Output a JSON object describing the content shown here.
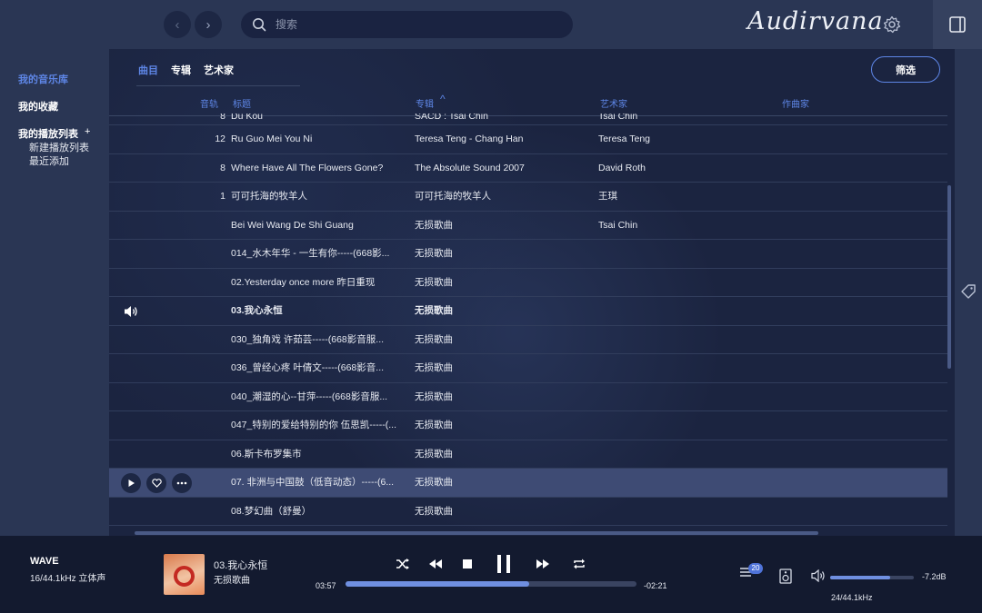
{
  "topbar": {
    "back": "‹",
    "forward": "›",
    "search_placeholder": "搜索",
    "logo": "Audirvana"
  },
  "sidebar": {
    "items": [
      {
        "label": "我的音乐库",
        "active": true
      },
      {
        "label": "我的收藏",
        "active": false
      },
      {
        "label": "我的播放列表",
        "active": false
      }
    ],
    "plus": "+",
    "sub_items": [
      {
        "label": "新建播放列表"
      },
      {
        "label": "最近添加"
      }
    ]
  },
  "tabs": [
    {
      "label": "曲目",
      "active": true
    },
    {
      "label": "专辑",
      "active": false
    },
    {
      "label": "艺术家",
      "active": false
    }
  ],
  "filter_label": "筛选",
  "columns": {
    "track": "音轨",
    "title": "标题",
    "album": "专辑",
    "artist": "艺术家",
    "composer": "作曲家",
    "sort_indicator": "^"
  },
  "rows": [
    {
      "track": "8",
      "title": "Du Kou",
      "album": "SACD : Tsai Chin",
      "artist": "Tsai Chin"
    },
    {
      "track": "12",
      "title": "Ru Guo Mei You Ni",
      "album": "Teresa Teng - Chang Han",
      "artist": "Teresa Teng"
    },
    {
      "track": "8",
      "title": "Where Have All The Flowers Gone?",
      "album": "The Absolute Sound 2007",
      "artist": "David Roth"
    },
    {
      "track": "1",
      "title": "可可托海的牧羊人",
      "album": "可可托海的牧羊人",
      "artist": "王琪"
    },
    {
      "track": "",
      "title": "Bei Wei Wang De Shi Guang",
      "album": "无损歌曲",
      "artist": "Tsai Chin"
    },
    {
      "track": "",
      "title": "014_水木年华 - 一生有你-----(668影...",
      "album": "无损歌曲",
      "artist": ""
    },
    {
      "track": "",
      "title": "02.Yesterday once more 昨日重现",
      "album": "无损歌曲",
      "artist": ""
    },
    {
      "track": "",
      "title": "03.我心永恒",
      "album": "无损歌曲",
      "artist": "",
      "playing": true
    },
    {
      "track": "",
      "title": "030_独角戏  许茹芸-----(668影音服...",
      "album": "无损歌曲",
      "artist": ""
    },
    {
      "track": "",
      "title": "036_曾经心疼  叶倩文-----(668影音...",
      "album": "无损歌曲",
      "artist": ""
    },
    {
      "track": "",
      "title": "040_潮湿的心--甘萍-----(668影音服...",
      "album": "无损歌曲",
      "artist": ""
    },
    {
      "track": "",
      "title": "047_特别的爱给特别的你  伍思凯-----(...",
      "album": "无损歌曲",
      "artist": ""
    },
    {
      "track": "",
      "title": "06.斯卡布罗集市",
      "album": "无损歌曲",
      "artist": ""
    },
    {
      "track": "",
      "title": "07. 非洲与中国鼓（低音动态）-----(6...",
      "album": "无损歌曲",
      "artist": "",
      "selected": true
    },
    {
      "track": "",
      "title": "08.梦幻曲（舒曼）",
      "album": "无损歌曲",
      "artist": ""
    }
  ],
  "player": {
    "format": "WAVE",
    "format_detail": "16/44.1kHz 立体声",
    "song": "03.我心永恒",
    "album": "无损歌曲",
    "elapsed": "03:57",
    "remaining": "-02:21",
    "progress": 0.63,
    "queue_count": "20",
    "volume": 0.72,
    "volume_db": "-7.2dB",
    "output_format": "24/44.1kHz"
  },
  "colors": {
    "accent": "#5e86e6",
    "background": "#1b2440",
    "panel": "#2a3654"
  }
}
